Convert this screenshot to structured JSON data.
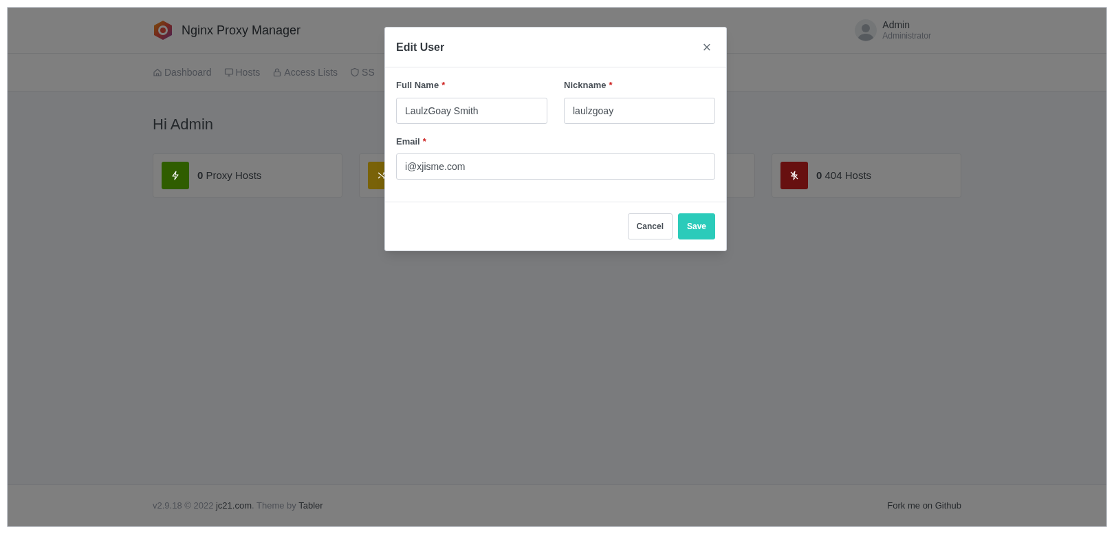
{
  "header": {
    "app_name": "Nginx Proxy Manager",
    "user": {
      "name": "Admin",
      "role": "Administrator"
    }
  },
  "nav": [
    {
      "label": "Dashboard",
      "kind": "home"
    },
    {
      "label": "Hosts",
      "kind": "monitor"
    },
    {
      "label": "Access Lists",
      "kind": "lock"
    },
    {
      "label": "SS",
      "kind": "shield"
    }
  ],
  "greeting": "Hi Admin",
  "cards": [
    {
      "count": "0",
      "label": "Proxy Hosts",
      "color": "#2f5d00",
      "kind": "bolt"
    },
    {
      "color": "#796208",
      "kind": "shuffle"
    },
    {
      "kind": "hidden"
    },
    {
      "count": "0",
      "label": "404 Hosts",
      "color": "#671010",
      "kind": "bolt-off"
    }
  ],
  "modal": {
    "title": "Edit User",
    "close": "×",
    "fields": [
      {
        "label": "Full Name",
        "required_mark": "*",
        "value": "LaulzGoay Smith"
      },
      {
        "label": "Nickname",
        "required_mark": "*",
        "value": "laulzgoay"
      },
      {
        "label": "Email",
        "required_mark": "*",
        "value": "i@xjisme.com"
      }
    ],
    "buttons": [
      {
        "label": "Cancel",
        "kind": "secondary"
      },
      {
        "label": "Save",
        "kind": "primary"
      }
    ]
  },
  "footer": {
    "version": "v2.9.18 © 2022",
    "site_link": "jc21.com",
    "theme_text": ". Theme by",
    "theme_link": "Tabler",
    "github_link": "Fork me on Github"
  }
}
